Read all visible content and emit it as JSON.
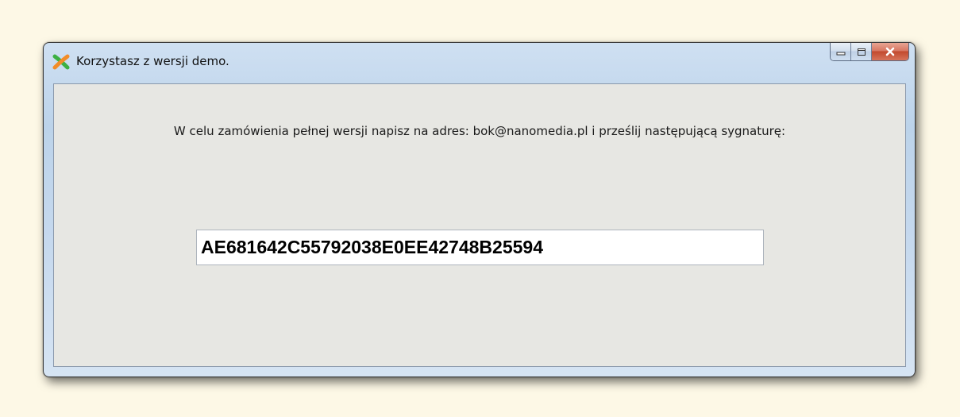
{
  "window": {
    "title": "Korzystasz z wersji demo.",
    "controls": {
      "minimize_icon": "minimize-icon",
      "maximize_icon": "maximize-icon",
      "close_icon": "close-icon"
    }
  },
  "dialog": {
    "message": "W celu zamówienia pełnej wersji napisz na adres: bok@nanomedia.pl i prześlij następującą sygnaturę:",
    "signature": "AE681642C55792038E0EE42748B25594"
  },
  "colors": {
    "desktop_background": "#fdf8e6",
    "client_background": "#e7e7e3",
    "close_button": "#c24a2f",
    "icon_green": "#3cb043",
    "icon_orange": "#f28c28"
  }
}
